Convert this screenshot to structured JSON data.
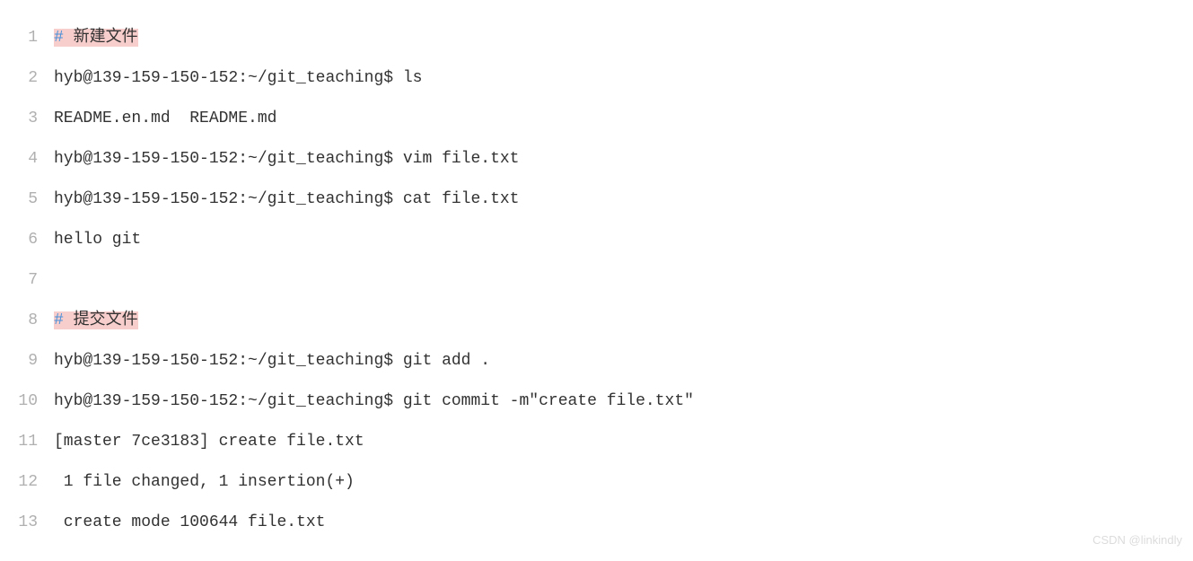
{
  "lines": [
    {
      "num": "1",
      "parts": [
        {
          "cls": "comment-hash",
          "text": "#"
        },
        {
          "cls": "comment-text",
          "text": " 新建文件"
        }
      ]
    },
    {
      "num": "2",
      "parts": [
        {
          "cls": "",
          "text": "hyb@139-159-150-152:~/git_teaching$ ls"
        }
      ]
    },
    {
      "num": "3",
      "parts": [
        {
          "cls": "",
          "text": "README.en.md  README.md"
        }
      ]
    },
    {
      "num": "4",
      "parts": [
        {
          "cls": "",
          "text": "hyb@139-159-150-152:~/git_teaching$ vim file.txt"
        }
      ]
    },
    {
      "num": "5",
      "parts": [
        {
          "cls": "",
          "text": "hyb@139-159-150-152:~/git_teaching$ cat file.txt"
        }
      ]
    },
    {
      "num": "6",
      "parts": [
        {
          "cls": "",
          "text": "hello git"
        }
      ]
    },
    {
      "num": "7",
      "parts": [
        {
          "cls": "",
          "text": ""
        }
      ]
    },
    {
      "num": "8",
      "parts": [
        {
          "cls": "comment-hash",
          "text": "#"
        },
        {
          "cls": "comment-text",
          "text": " 提交文件"
        }
      ]
    },
    {
      "num": "9",
      "parts": [
        {
          "cls": "",
          "text": "hyb@139-159-150-152:~/git_teaching$ git add ."
        }
      ]
    },
    {
      "num": "10",
      "parts": [
        {
          "cls": "",
          "text": "hyb@139-159-150-152:~/git_teaching$ git commit -m\"create file.txt\""
        }
      ]
    },
    {
      "num": "11",
      "parts": [
        {
          "cls": "",
          "text": "[master 7ce3183] create file.txt"
        }
      ]
    },
    {
      "num": "12",
      "parts": [
        {
          "cls": "",
          "text": " 1 file changed, 1 insertion(+)"
        }
      ]
    },
    {
      "num": "13",
      "parts": [
        {
          "cls": "",
          "text": " create mode 100644 file.txt"
        }
      ]
    }
  ],
  "watermark": "CSDN @linkindly"
}
